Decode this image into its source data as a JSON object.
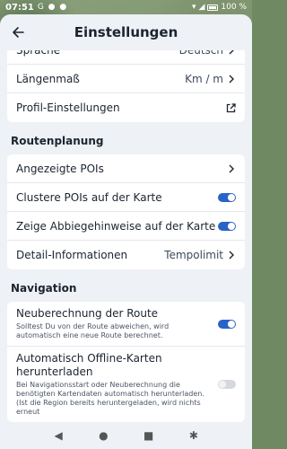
{
  "status": {
    "time": "07:51",
    "left_icons": "G ● ●",
    "battery": "100 %"
  },
  "appbar": {
    "title": "Einstellungen"
  },
  "card1": [
    {
      "label": "Sprache",
      "value": "Deutsch",
      "icon": "chevron-right-icon"
    },
    {
      "label": "Längenmaß",
      "value": "Km / m",
      "icon": "chevron-right-icon"
    },
    {
      "label": "Profil-Einstellungen",
      "value": "",
      "icon": "open-external-icon"
    }
  ],
  "section_routenplanung": "Routenplanung",
  "card2": [
    {
      "label": "Angezeigte POIs",
      "value": "",
      "icon": "chevron-right-icon"
    },
    {
      "label": "Clustere POIs auf der Karte",
      "toggle": "on"
    },
    {
      "label": "Zeige Abbiegehinweise auf der Karte",
      "toggle": "on"
    },
    {
      "label": "Detail-Informationen",
      "value": "Tempolimit",
      "icon": "chevron-right-icon"
    }
  ],
  "section_navigation": "Navigation",
  "card3": [
    {
      "label": "Neuberechnung der Route",
      "sub": "Solltest Du von der Route abweichen, wird automatisch eine neue Route berechnet.",
      "toggle": "on"
    },
    {
      "label": "Automatisch Offline-Karten herunterladen",
      "sub": "Bei Navigationsstart oder Neuberechnung die benötigten Kartendaten automatisch herunterladen. (Ist die Region bereits heruntergeladen, wird nichts erneut",
      "toggle": "off"
    }
  ],
  "colors": {
    "accent": "#2a63c8",
    "sheet": "#eef1f6",
    "card": "#ffffff"
  }
}
